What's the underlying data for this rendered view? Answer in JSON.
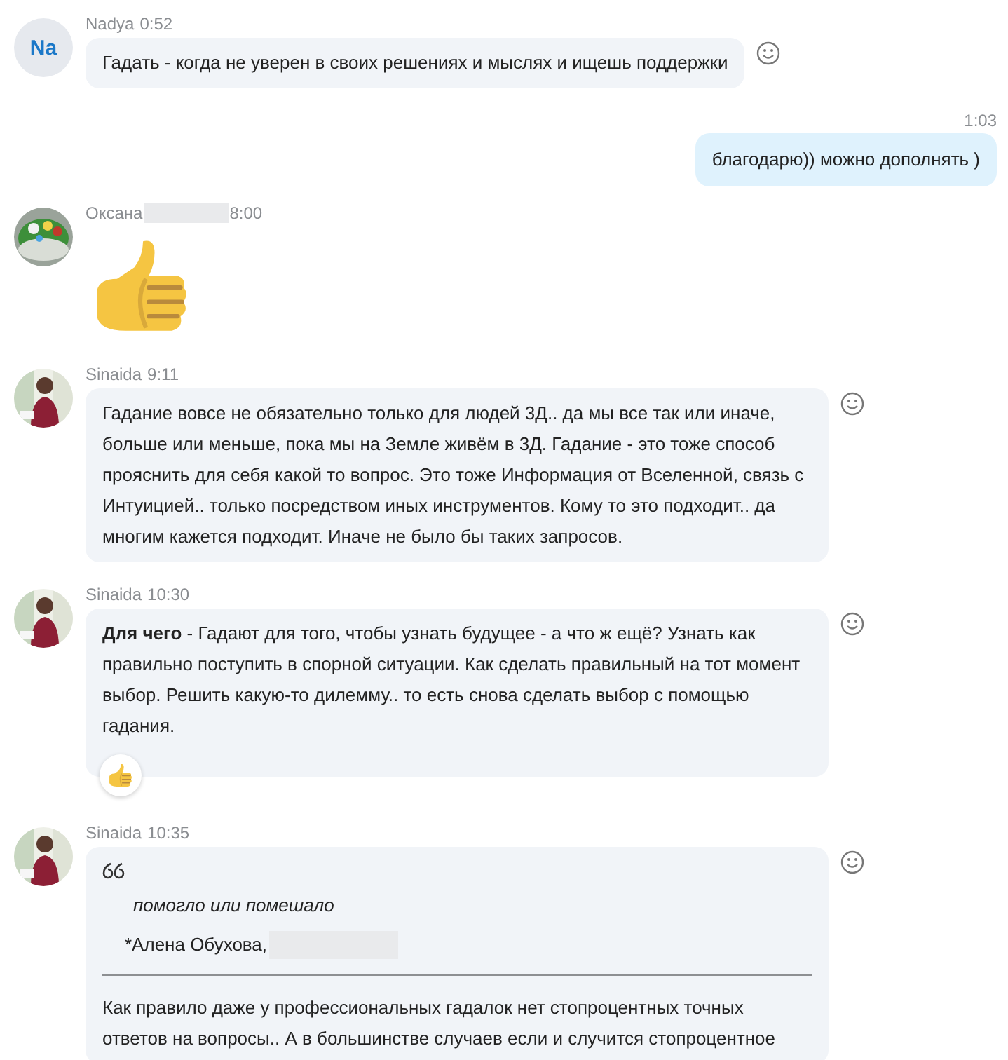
{
  "messages": [
    {
      "kind": "text",
      "author": "Nadya",
      "time": "0:52",
      "avatar": {
        "kind": "initials",
        "text": "Na"
      },
      "react_button": true,
      "text": "Гадать - когда не уверен в своих решениях и мыслях и ищешь поддержки"
    },
    {
      "kind": "outgoing",
      "time": "1:03",
      "text": "благодарю)) можно дополнять )"
    },
    {
      "kind": "emoji",
      "author": "Оксана",
      "name_redacted": true,
      "time": "8:00",
      "avatar": {
        "kind": "cake"
      }
    },
    {
      "kind": "text",
      "author": "Sinaida",
      "time": "9:11",
      "avatar": {
        "kind": "portrait"
      },
      "react_button": true,
      "text": "Гадание вовсе не обязательно только для людей 3Д..  да мы все так или иначе, больше или меньше, пока мы на Земле живём в 3Д. Гадание - это тоже способ прояснить для себя какой то вопрос. Это тоже Информация от Вселенной, связь с Интуицией.. только посредством иных инструментов. Кому то это подходит.. да многим кажется подходит. Иначе не было бы таких запросов."
    },
    {
      "kind": "text",
      "author": "Sinaida",
      "time": "10:30",
      "avatar": {
        "kind": "portrait"
      },
      "react_button": true,
      "reaction": true,
      "text": "**Для чего** - Гадают для того, чтобы узнать будущее - а что ж ещё? Узнать как правильно поступить в спорной ситуации. Как сделать правильный на тот момент выбор. Решить какую-то дилемму.. то есть снова сделать выбор с помощью гадания."
    },
    {
      "kind": "quote",
      "author": "Sinaida",
      "time": "10:35",
      "avatar": {
        "kind": "portrait"
      },
      "react_button": true,
      "quote": "помогло или помешало",
      "quote_author": "*Алена Обухова,",
      "author_redacted": true,
      "text": "Как правило даже у профессиональных гадалок нет стопроцентных точных ответов на вопросы.. А в большинстве случаев если и случится стопроцентное"
    }
  ]
}
